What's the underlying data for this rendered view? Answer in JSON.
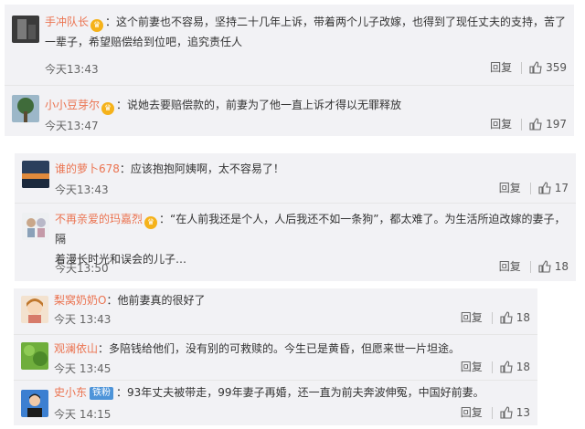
{
  "groups": [
    {
      "comments": [
        {
          "avatar_icon": "avatar-dark-photo-icon",
          "name": "手冲队长",
          "badge": "gold-crown-badge",
          "sep": "：",
          "text_line1": "这个前妻也不容易，坚持二十几年上诉，带着两个儿子改嫁，也得到了现任丈夫的支持，苦了",
          "text_line2": "一辈子，希望赔偿给到位吧，追究责任人",
          "time": "今天13:43",
          "reply": "回复",
          "likes": "359"
        },
        {
          "avatar_icon": "avatar-tree-icon",
          "name": "小小豆芽尔",
          "badge": "gold-crown-badge",
          "sep": "：",
          "text_line1": "说她去要赔偿款的，前妻为了他一直上诉才得以无罪释放",
          "time": "今天13:47",
          "reply": "回复",
          "likes": "197"
        }
      ]
    },
    {
      "comments": [
        {
          "avatar_icon": "avatar-sunset-icon",
          "name": "谁的萝卜678",
          "sep": "：",
          "text_line1": "应该抱抱阿姨啊，太不容易了！",
          "time": "今天13:43",
          "reply": "回复",
          "likes": "17"
        },
        {
          "avatar_icon": "avatar-cartoon-icon",
          "name": "不再亲爱的玛嘉烈",
          "badge": "gold-crown-badge",
          "sep": "：",
          "text_line1": "“在人前我还是个人，人后我还不如一条狗”，都太难了。为生活所迫改嫁的妻子，隔",
          "text_line2": "着漫长时光和误会的儿子…",
          "time": "今天13:50",
          "reply": "回复",
          "likes": "18"
        }
      ]
    },
    {
      "comments": [
        {
          "avatar_icon": "avatar-anime-girl-icon",
          "name": "梨窝奶奶O",
          "sep": "：",
          "text_line1": "他前妻真的很好了",
          "time": "今天 13:43",
          "reply": "回复",
          "likes": "18"
        },
        {
          "avatar_icon": "avatar-green-leaf-icon",
          "name": "观澜依山",
          "sep": "：",
          "text_line1": "多陪钱给他们，没有别的可救赎的。今生已是黄昏，但愿来世一片坦途。",
          "time": "今天 13:45",
          "reply": "回复",
          "likes": "18"
        },
        {
          "avatar_icon": "avatar-person-icon",
          "name": "史小东",
          "badge_vip": "铁粉",
          "sep": "：",
          "text_line1": "93年丈夫被带走，99年妻子再婚，还一直为前夫奔波伸冤，中国好前妻。",
          "time": "今天 14:15",
          "reply": "回复",
          "likes": "13"
        }
      ]
    }
  ]
}
